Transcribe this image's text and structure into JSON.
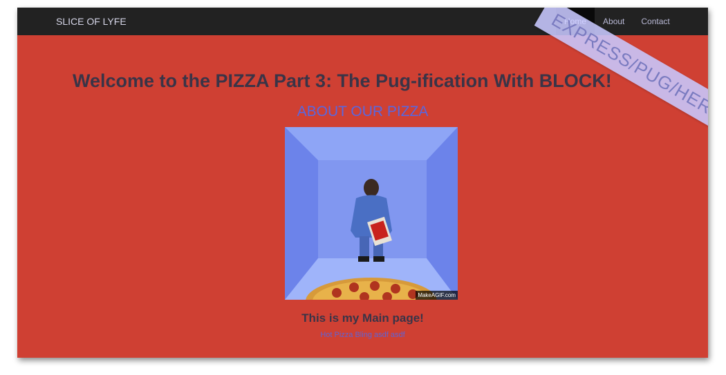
{
  "navbar": {
    "brand": "SLICE OF LYFE",
    "items": [
      {
        "label": "Home",
        "active": true
      },
      {
        "label": "About",
        "active": false
      },
      {
        "label": "Contact",
        "active": false
      }
    ]
  },
  "ribbon": {
    "text": "EXPRESS/PUG/HEROKU"
  },
  "main": {
    "headline": "Welcome to the PIZZA Part 3: The Pug-ification With BLOCK!",
    "about_heading": "ABOUT OUR PIZZA",
    "gif_watermark": "MakeAGIF.com",
    "page_title": "This is my Main page!",
    "subtext": "Hot Pizza Bling asdf asdf"
  },
  "colors": {
    "page_background": "#cf4033",
    "navbar": "#222222",
    "about_heading": "#5867e0",
    "ribbon": "#c8c8ff"
  }
}
